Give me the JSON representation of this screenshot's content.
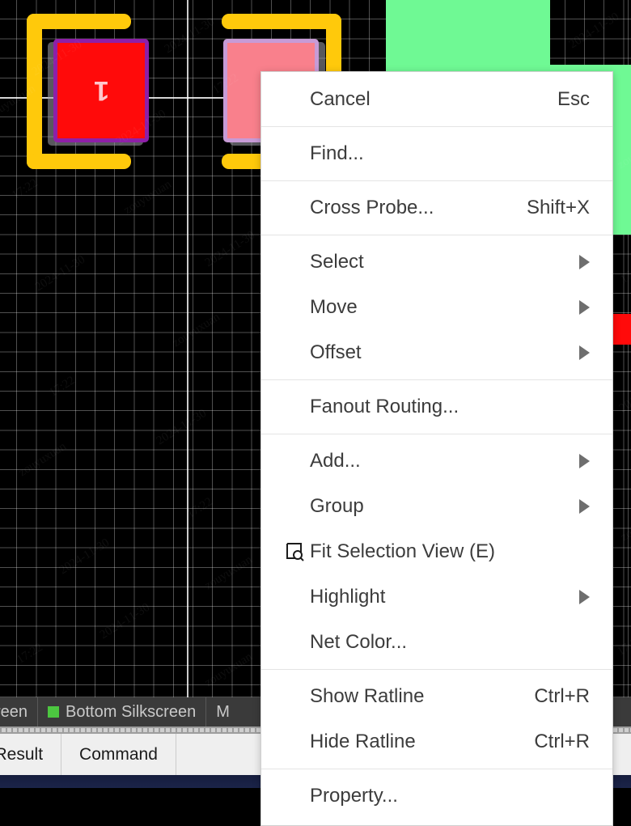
{
  "app": {
    "watermark_text": "zouyuxuan",
    "watermark_date": "2024-11-30",
    "watermark_time": "17:22"
  },
  "canvas": {
    "name": "pcb-editor-canvas",
    "background_color": "#000000",
    "grid_color": "#EBEBEB",
    "pads": [
      {
        "designator": "1",
        "state": "selected",
        "fill": "#FF0A0A",
        "border": "#8E1FA8"
      },
      {
        "designator": "",
        "state": "unselected",
        "fill": "#F9808C",
        "border": "#C79BD6"
      }
    ],
    "silkscreen_color": "#FFC90B",
    "copper_area_color": "#6FF994"
  },
  "layer_bar": {
    "name": "layer-selector-bar",
    "layers": [
      {
        "label": "creen",
        "color": "#CCCCCC",
        "truncated": true
      },
      {
        "label": "Bottom Silkscreen",
        "color": "#4CC740",
        "truncated": false
      },
      {
        "label": "M",
        "color": "#CCCCCC",
        "truncated": true
      }
    ]
  },
  "bottom_tabs": {
    "name": "bottom-panel-tabs",
    "tabs": [
      {
        "label": "d Result",
        "active": false
      },
      {
        "label": "Command",
        "active": false
      }
    ]
  },
  "context_menu": {
    "name": "pcb-context-menu",
    "items": [
      {
        "label": "Cancel",
        "accel": "Esc",
        "submenu": false,
        "icon": null
      },
      {
        "type": "separator"
      },
      {
        "label": "Find...",
        "accel": "",
        "submenu": false,
        "icon": null
      },
      {
        "type": "separator"
      },
      {
        "label": "Cross Probe...",
        "accel": "Shift+X",
        "submenu": false,
        "icon": null
      },
      {
        "type": "separator"
      },
      {
        "label": "Select",
        "accel": "",
        "submenu": true,
        "icon": null
      },
      {
        "label": "Move",
        "accel": "",
        "submenu": true,
        "icon": null
      },
      {
        "label": "Offset",
        "accel": "",
        "submenu": true,
        "icon": null
      },
      {
        "type": "separator"
      },
      {
        "label": "Fanout Routing...",
        "accel": "",
        "submenu": false,
        "icon": null
      },
      {
        "type": "separator"
      },
      {
        "label": "Add...",
        "accel": "",
        "submenu": true,
        "icon": null
      },
      {
        "label": "Group",
        "accel": "",
        "submenu": true,
        "icon": null
      },
      {
        "label": "Fit Selection View (E)",
        "accel": "",
        "submenu": false,
        "icon": "fit-selection-view-icon"
      },
      {
        "label": "Highlight",
        "accel": "",
        "submenu": true,
        "icon": null
      },
      {
        "label": "Net Color...",
        "accel": "",
        "submenu": false,
        "icon": null
      },
      {
        "type": "separator"
      },
      {
        "label": "Show Ratline",
        "accel": "Ctrl+R",
        "submenu": false,
        "icon": null
      },
      {
        "label": "Hide Ratline",
        "accel": "Ctrl+R",
        "submenu": false,
        "icon": null
      },
      {
        "type": "separator"
      },
      {
        "label": "Property...",
        "accel": "",
        "submenu": false,
        "icon": null
      }
    ]
  }
}
